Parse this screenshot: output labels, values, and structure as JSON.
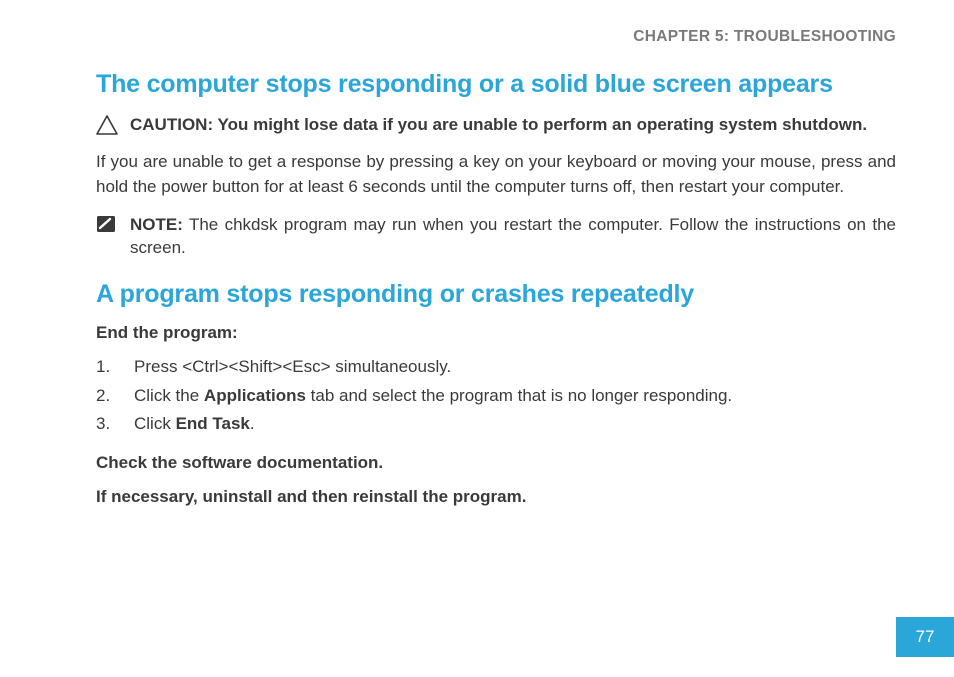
{
  "chapter_header": "CHAPTER 5: TROUBLESHOOTING",
  "section1": {
    "title": "The computer stops responding or a solid blue screen appears",
    "caution": "CAUTION: You might lose data if you are unable to perform an operating system shutdown.",
    "body": "If you are unable to get a response by pressing a key on your keyboard or moving your mouse, press and hold the power button for at least 6 seconds until the computer turns off, then restart your computer.",
    "note_label": "NOTE:",
    "note_body": " The chkdsk program may run when you restart the computer. Follow the instructions on the screen."
  },
  "section2": {
    "title": "A program stops responding or crashes repeatedly",
    "subhead1": "End the program:",
    "steps": {
      "s1_pre": "Press ",
      "s1_kbd": "<Ctrl><Shift><Esc>",
      "s1_post": " simultaneously.",
      "s2_pre": "Click the ",
      "s2_bold": "Applications",
      "s2_post": " tab and select the program that is no longer responding.",
      "s3_pre": "Click ",
      "s3_bold": "End Task",
      "s3_post": "."
    },
    "subhead2": "Check the software documentation.",
    "subhead3": "If necessary, uninstall and then reinstall the program."
  },
  "page_number": "77"
}
